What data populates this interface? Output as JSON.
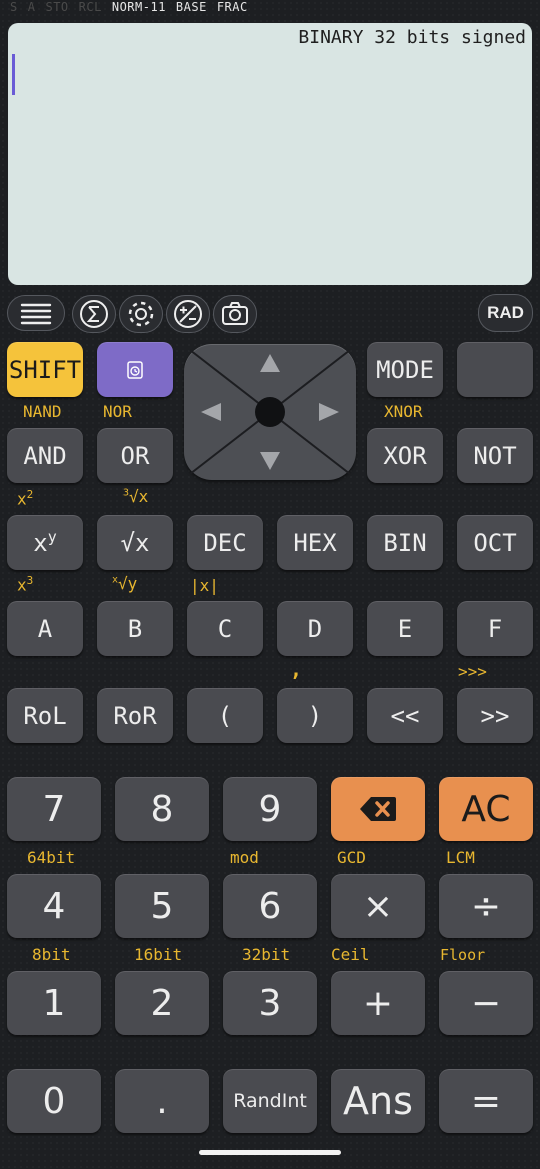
{
  "status_bar": {
    "items": [
      "S",
      "A",
      "STO",
      "RCL",
      "NORM-11",
      "BASE",
      "FRAC"
    ]
  },
  "display": {
    "mode_text": "BINARY 32 bits signed",
    "input_value": ""
  },
  "toolbar": {
    "rad_label": "RAD"
  },
  "colors": {
    "accent_yellow": "#f5c33b",
    "accent_purple": "#7e6bc7",
    "accent_orange": "#e8904f",
    "label_gold": "#e8b730",
    "display_bg": "#d9e5e3"
  },
  "keys": {
    "shift": "SHIFT",
    "mode": "MODE",
    "and": "AND",
    "or": "OR",
    "xor": "XOR",
    "not": "NOT",
    "nand": "NAND",
    "nor": "NOR",
    "xnor": "XNOR",
    "dec": "DEC",
    "hex": "HEX",
    "bin": "BIN",
    "oct": "OCT",
    "a": "A",
    "b": "B",
    "c": "C",
    "d": "D",
    "e": "E",
    "f": "F",
    "abs_label": "|x|",
    "comma_label": ",",
    "shift_right3_label": ">>>",
    "rol": "RoL",
    "ror": "RoR",
    "lparen": "(",
    "rparen": ")",
    "shl": "<<",
    "shr": ">>",
    "n7": "7",
    "n8": "8",
    "n9": "9",
    "ac": "AC",
    "n4": "4",
    "n5": "5",
    "n6": "6",
    "mul": "×",
    "div": "÷",
    "n1": "1",
    "n2": "2",
    "n3": "3",
    "add": "+",
    "sub": "−",
    "n0": "0",
    "dot": ".",
    "randint": "RandInt",
    "ans": "Ans",
    "eq": "=",
    "lbl_64bit": "64bit",
    "lbl_mod": "mod",
    "lbl_gcd": "GCD",
    "lbl_lcm": "LCM",
    "lbl_8bit": "8bit",
    "lbl_16bit": "16bit",
    "lbl_32bit": "32bit",
    "lbl_ceil": "Ceil",
    "lbl_floor": "Floor"
  }
}
